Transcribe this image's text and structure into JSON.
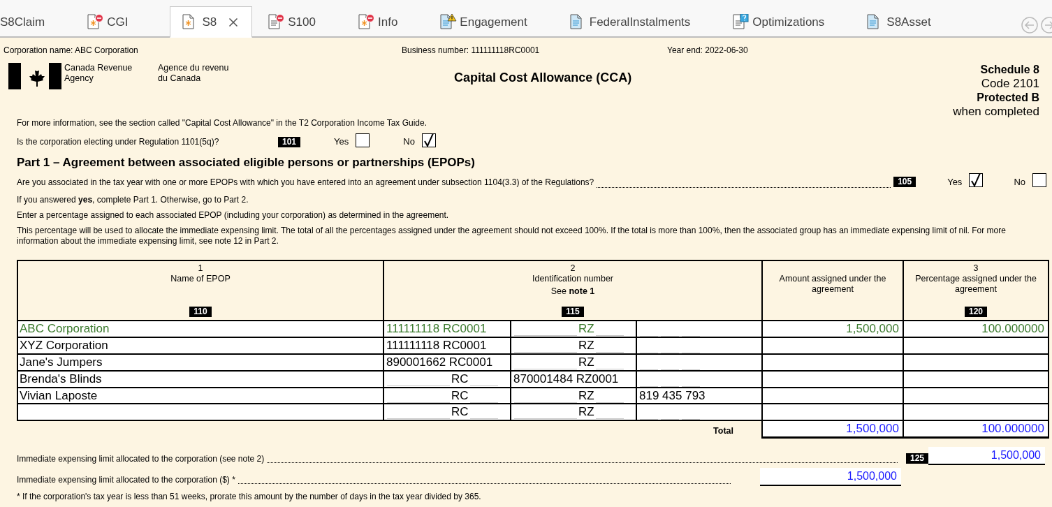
{
  "tabs": [
    {
      "label": "S8Claim",
      "kind": "none",
      "selected": false
    },
    {
      "label": "CGI",
      "kind": "form-error",
      "selected": false
    },
    {
      "label": "S8",
      "kind": "form",
      "selected": true
    },
    {
      "label": "S100",
      "kind": "doc-error",
      "selected": false
    },
    {
      "label": "Info",
      "kind": "form-error",
      "selected": false
    },
    {
      "label": "Engagement",
      "kind": "blue-warning",
      "selected": false
    },
    {
      "label": "FederalInstalments",
      "kind": "blue",
      "selected": false
    },
    {
      "label": "Optimizations",
      "kind": "doc-question",
      "selected": false
    },
    {
      "label": "S8Asset",
      "kind": "blue",
      "selected": false
    }
  ],
  "header": {
    "corporation_name": "Corporation name: ABC Corporation",
    "business_number": "Business number: 111111118RC0001",
    "year_end": "Year end: 2022-06-30"
  },
  "agency": {
    "english": [
      "Canada Revenue",
      "Agency"
    ],
    "french": [
      "Agence du revenu",
      "du Canada"
    ]
  },
  "form_title": "Capital Cost Allowance (CCA)",
  "schedule": {
    "name": "Schedule 8",
    "code": "Code 2101",
    "protection": "Protected B",
    "note": "when completed"
  },
  "intro": "For more information, see the section called \"Capital Cost Allowance\" in the T2 Corporation Income Tax Guide.",
  "election": {
    "question": "Is the corporation electing under Regulation 1101(5q)?",
    "code": "101",
    "options": [
      {
        "label": "Yes",
        "checked": false
      },
      {
        "label": "No",
        "checked": true
      }
    ]
  },
  "part1": {
    "heading": "Part 1 – Agreement between associated eligible persons or partnerships (EPOPs)",
    "question": {
      "text": "Are you associated in the tax year with one or more EPOPs with which you have entered into an agreement under subsection 1104(3.3) of the Regulations?",
      "code": "105",
      "options": [
        {
          "label": "Yes",
          "checked": true
        },
        {
          "label": "No",
          "checked": false
        }
      ]
    },
    "paragraphs": [
      "If you answered **yes**, complete Part 1. Otherwise, go to Part 2.",
      "Enter a percentage assigned to each associated EPOP (including your corporation) as determined in the agreement.",
      "This percentage will be used to allocate the immediate expensing limit. The total of all the percentages assigned under the agreement should not exceed 100%. If the total is more than 100%, then the associated group has an immediate expensing limit of nil. For more information about the immediate expensing limit, see note 12 in Part 2."
    ],
    "table": {
      "columns": [
        {
          "number": "1",
          "title": "Name of EPOP",
          "code": "110"
        },
        {
          "number": "2",
          "title": "Identification number",
          "note": "See **note 1**",
          "code": "115"
        },
        {
          "title": "Amount assigned under the agreement"
        },
        {
          "number": "3",
          "title": "Percentage assigned under the agreement",
          "code": "120"
        }
      ],
      "rows": [
        {
          "highlighted": true,
          "name": "ABC Corporation",
          "id_parts": [
            {
              "kind": "filled",
              "text": "111111118 RC0001"
            },
            {
              "kind": "template",
              "text": "RZ"
            },
            {
              "kind": "blank"
            }
          ],
          "amount": "1,500,000",
          "percentage": "100.000000"
        },
        {
          "highlighted": false,
          "name": "XYZ Corporation",
          "id_parts": [
            {
              "kind": "filled",
              "text": "111111118 RC0001"
            },
            {
              "kind": "template",
              "text": "RZ"
            },
            {
              "kind": "blank"
            }
          ]
        },
        {
          "highlighted": false,
          "name": "Jane's Jumpers",
          "id_parts": [
            {
              "kind": "filled",
              "text": "890001662 RC0001"
            },
            {
              "kind": "template",
              "text": "RZ"
            },
            {
              "kind": "blank"
            }
          ]
        },
        {
          "highlighted": false,
          "name": "Brenda's Blinds",
          "id_parts": [
            {
              "kind": "template",
              "text": "RC"
            },
            {
              "kind": "filled",
              "text": "870001484 RZ0001"
            },
            {
              "kind": "blank"
            }
          ]
        },
        {
          "highlighted": false,
          "name": "Vivian Laposte",
          "id_parts": [
            {
              "kind": "template",
              "text": "RC"
            },
            {
              "kind": "template",
              "text": "RZ"
            },
            {
              "kind": "filled",
              "text": "819 435 793"
            }
          ]
        },
        {
          "highlighted": false,
          "id_parts": [
            {
              "kind": "template",
              "text": "RC"
            },
            {
              "kind": "template",
              "text": "RZ"
            },
            {
              "kind": "blank"
            }
          ]
        }
      ],
      "total": {
        "label": "Total",
        "amount": "1,500,000",
        "percentage": "100.000000"
      }
    }
  },
  "limit_lines": [
    {
      "kind": "coded",
      "label": "Immediate expensing limit allocated to the corporation (see note 2)",
      "code": "125",
      "value": "1,500,000"
    },
    {
      "kind": "plain",
      "label": "Immediate expensing limit allocated to the corporation ($) *",
      "value": "1,500,000"
    }
  ],
  "footnote": "* If the corporation's tax year is less than 51 weeks, prorate this amount by the number of days in the tax year divided by 365."
}
